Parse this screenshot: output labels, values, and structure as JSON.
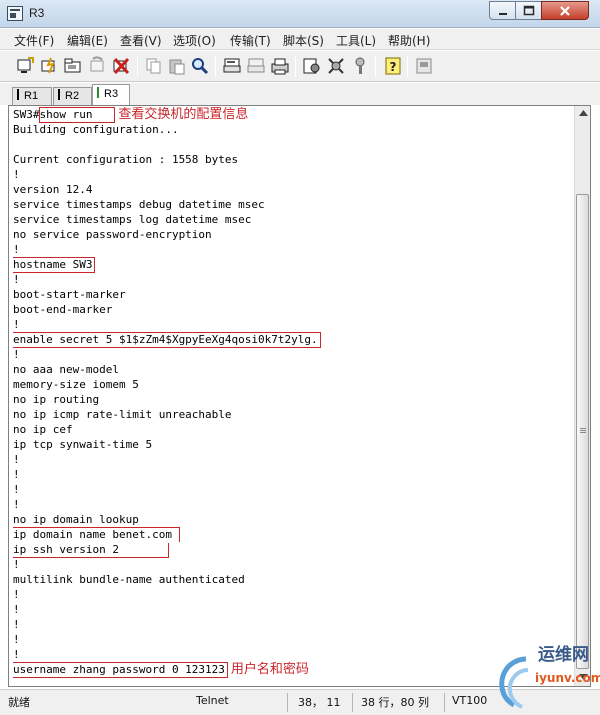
{
  "window": {
    "title": "R3"
  },
  "menu": [
    "文件(F)",
    "编辑(E)",
    "查看(V)",
    "选项(O)",
    "传输(T)",
    "脚本(S)",
    "工具(L)",
    "帮助(H)"
  ],
  "toolbar": [
    "connect-icon",
    "quick-connect-icon",
    "connect-in-tab-icon",
    "reconnect-icon",
    "disconnect-icon",
    "copy-icon",
    "paste-icon",
    "find-icon",
    "print-icon",
    "print-setup-icon",
    "print-screen-icon",
    "session-options-icon",
    "global-options-icon",
    "keymap-icon",
    "help-icon",
    "sftp-icon"
  ],
  "tabs": [
    {
      "label": "R1",
      "active": false
    },
    {
      "label": "R2",
      "active": false
    },
    {
      "label": "R3",
      "active": true
    }
  ],
  "terminal": {
    "lines": [
      "SW3#show run",
      "Building configuration...",
      "",
      "Current configuration : 1558 bytes",
      "!",
      "version 12.4",
      "service timestamps debug datetime msec",
      "service timestamps log datetime msec",
      "no service password-encryption",
      "!",
      "hostname SW3",
      "!",
      "boot-start-marker",
      "boot-end-marker",
      "!",
      "enable secret 5 $1$zZm4$XgpyEeXg4qosi0k7t2ylg.",
      "!",
      "no aaa new-model",
      "memory-size iomem 5",
      "no ip routing",
      "no ip icmp rate-limit unreachable",
      "no ip cef",
      "ip tcp synwait-time 5",
      "!",
      "!",
      "!",
      "!",
      "no ip domain lookup",
      "ip domain name benet.com",
      "ip ssh version 2",
      "!",
      "multilink bundle-name authenticated",
      "!",
      "!",
      "!",
      "!",
      "!",
      "username zhang password 0 123123"
    ],
    "annotations": {
      "show_run": "查看交换机的配置信息",
      "username": "用户名和密码"
    }
  },
  "status": {
    "ready": "就绪",
    "protocol": "Telnet",
    "cursor": "38， 11",
    "size": "38 行，80 列",
    "emulation": "VT100"
  },
  "watermark": {
    "line1": "运维网",
    "line2": "iyunv.com"
  }
}
